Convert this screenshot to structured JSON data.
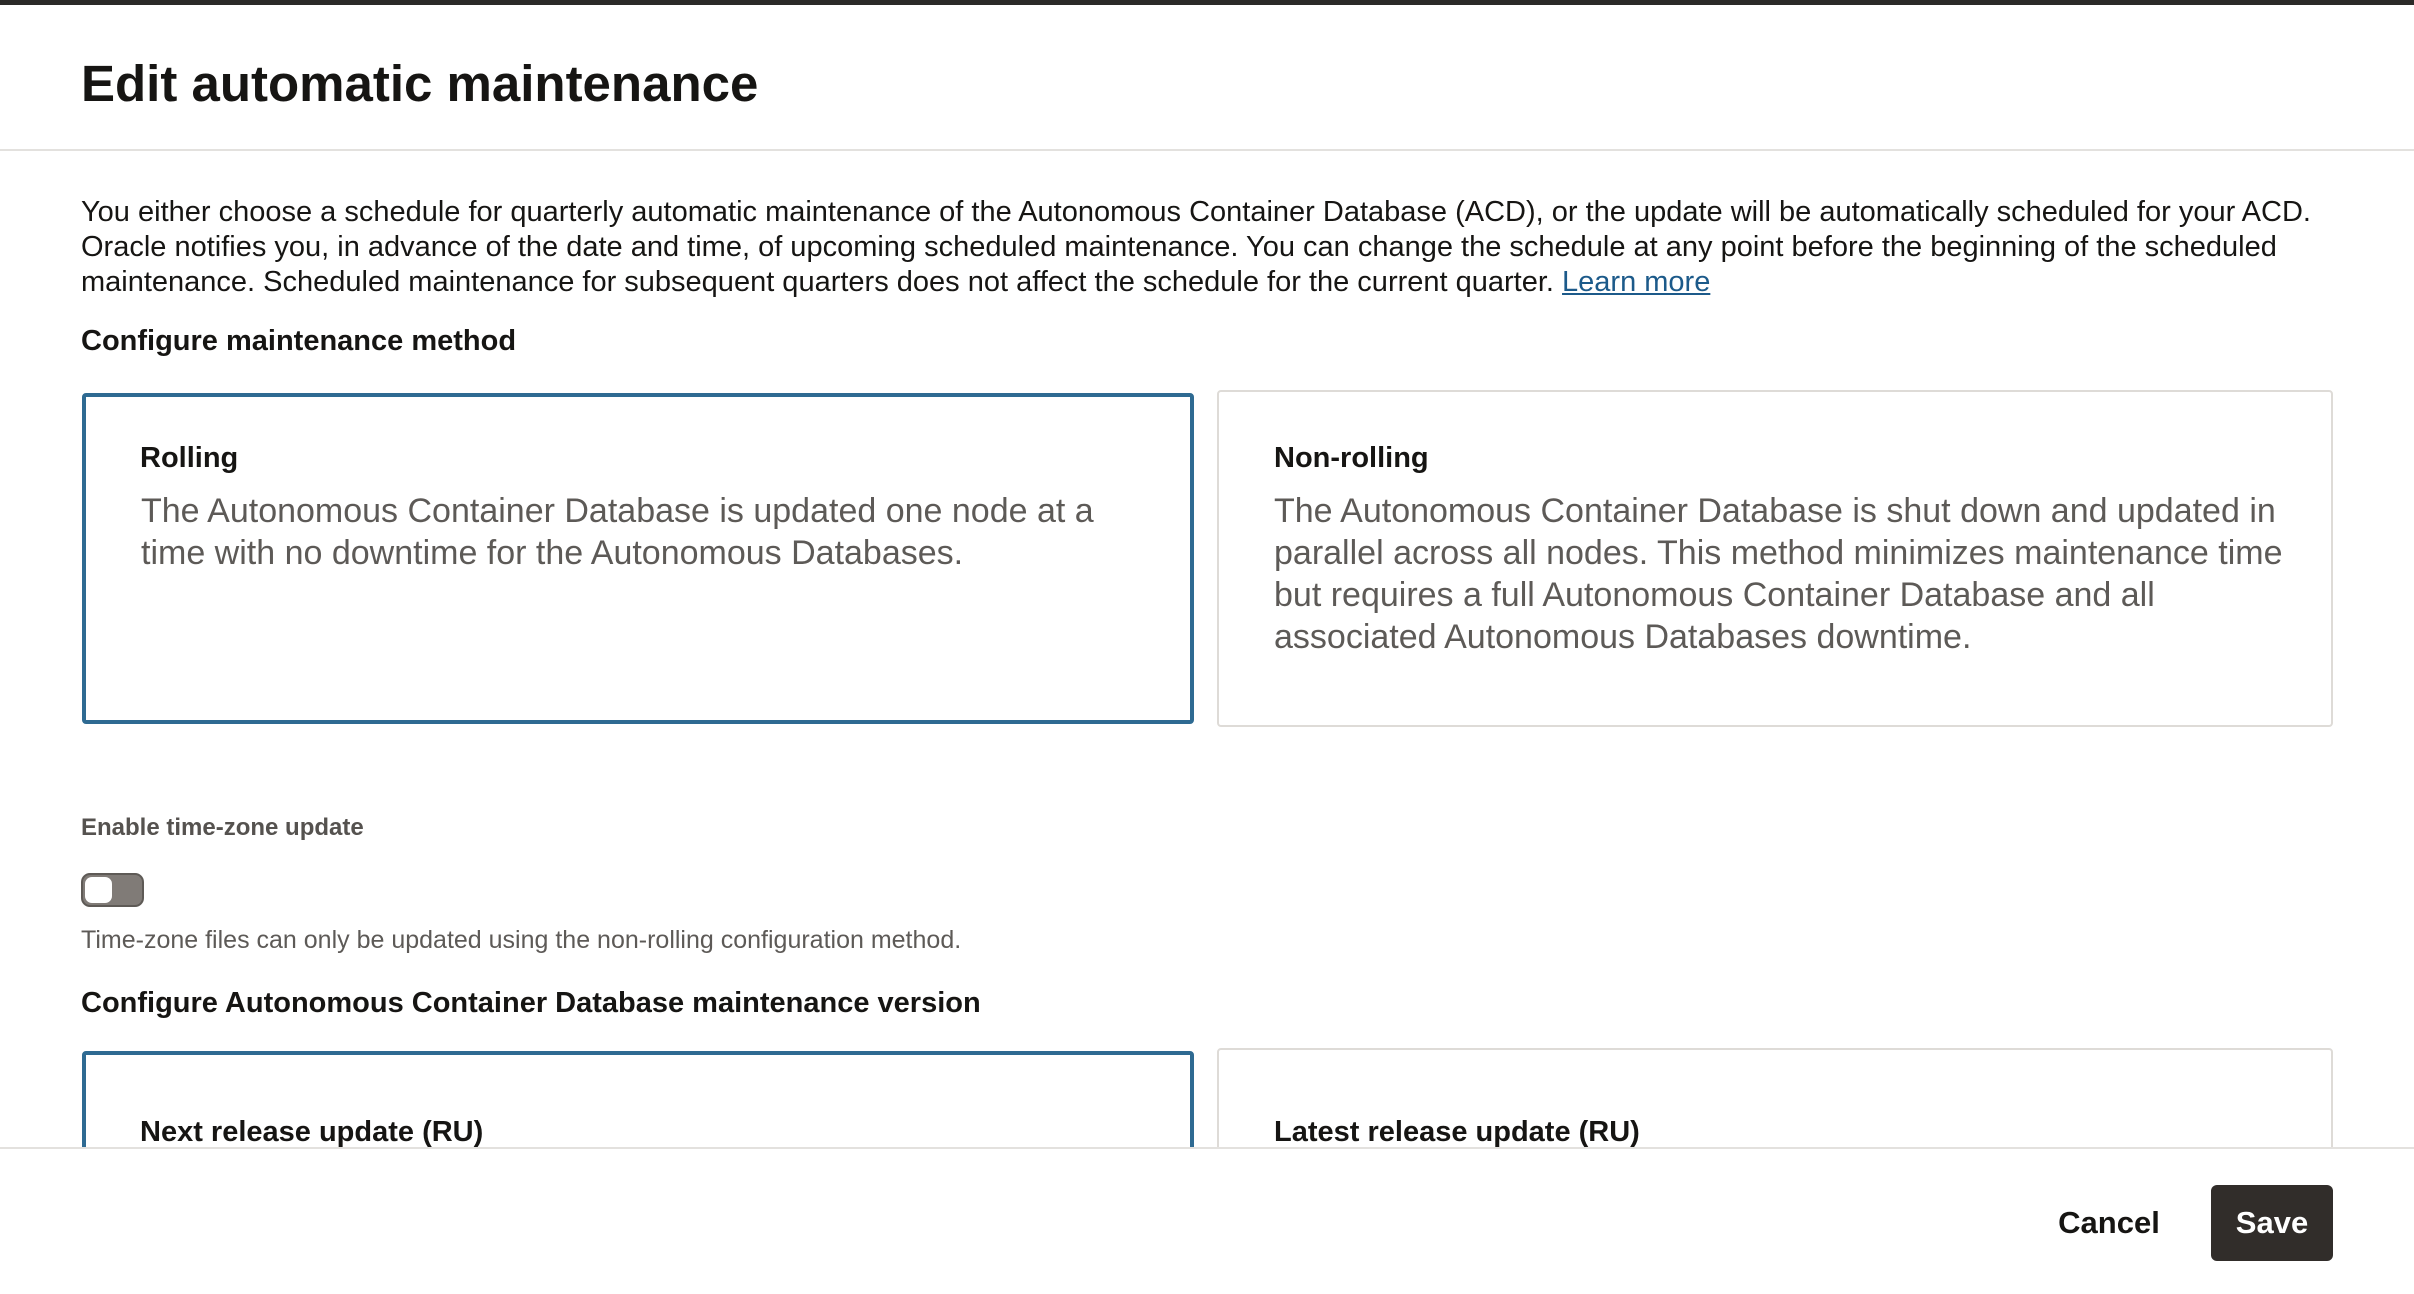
{
  "panel": {
    "title": "Edit automatic maintenance"
  },
  "intro": {
    "text": "You either choose a schedule for quarterly automatic maintenance of the Autonomous Container Database (ACD), or the update will be automatically scheduled for your ACD. Oracle notifies you, in advance of the date and time, of upcoming scheduled maintenance. You can change the schedule at any point before the beginning of the scheduled maintenance. Scheduled maintenance for subsequent quarters does not affect the schedule for the current quarter.",
    "link_label": "Learn more"
  },
  "maintenance_method": {
    "heading": "Configure maintenance method",
    "selected": "Rolling",
    "options": [
      {
        "title": "Rolling",
        "description": "The Autonomous Container Database is updated one node at a time with no downtime for the Autonomous Databases."
      },
      {
        "title": "Non-rolling",
        "description": "The Autonomous Container Database is shut down and updated in parallel across all nodes. This method minimizes maintenance time but requires a full Autonomous Container Database and all associated Autonomous Databases downtime."
      }
    ]
  },
  "time_zone": {
    "label": "Enable time-zone update",
    "enabled": false,
    "helper": "Time-zone files can only be updated using the non-rolling configuration method."
  },
  "maintenance_version": {
    "heading": "Configure Autonomous Container Database maintenance version",
    "selected": "Next release update (RU)",
    "options": [
      {
        "title": "Next release update (RU)"
      },
      {
        "title": "Latest release update (RU)"
      }
    ]
  },
  "footer": {
    "cancel_label": "Cancel",
    "save_label": "Save"
  },
  "colors": {
    "selected_border": "#2e6a92",
    "link": "#1c5a8a",
    "primary_button": "#312d2a"
  }
}
